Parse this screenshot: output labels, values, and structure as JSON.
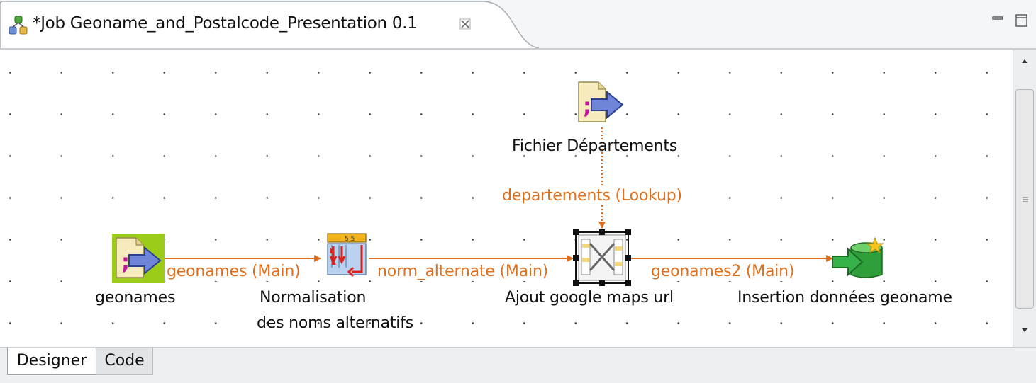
{
  "editor_tab": {
    "title": "*Job Geoname_and_Postalcode_Presentation 0.1",
    "close_icon": "close-x-icon",
    "job_icon": "talend-job-icon"
  },
  "window_controls": {
    "minimize": "minimize-icon",
    "maximize": "maximize-icon"
  },
  "diagram": {
    "nodes": [
      {
        "id": "geonames",
        "label": "geonames",
        "icon": "file-input-delimited-icon",
        "selected_bg": "#9ccc1a"
      },
      {
        "id": "normalisation",
        "label_line1": "Normalisation",
        "label_line2": "des noms alternatifs",
        "icon": "normalize-icon"
      },
      {
        "id": "fichier_departements",
        "label": "Fichier Départements",
        "icon": "file-input-delimited-icon"
      },
      {
        "id": "ajout",
        "label": "Ajout google maps url",
        "icon": "tmap-icon"
      },
      {
        "id": "insertion",
        "label": "Insertion données geoname",
        "icon": "db-output-icon"
      }
    ],
    "links": [
      {
        "label": "geonames (Main)"
      },
      {
        "label": "norm_alternate (Main)"
      },
      {
        "label": "departements (Lookup)"
      },
      {
        "label": "geonames2 (Main)"
      }
    ],
    "link_color": "#e06f1d"
  },
  "bottom_tabs": [
    {
      "label": "Designer",
      "active": true
    },
    {
      "label": "Code",
      "active": false
    }
  ]
}
